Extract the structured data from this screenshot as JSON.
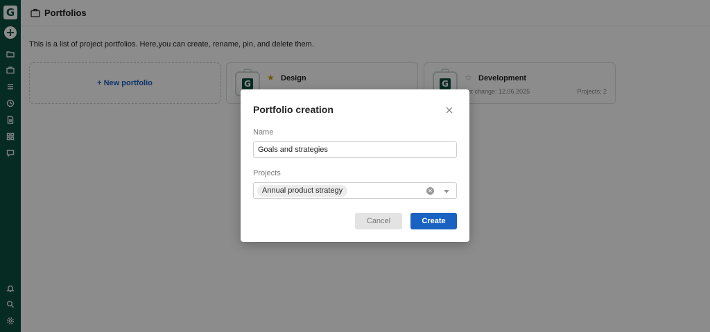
{
  "app": {
    "logo_letter": "G"
  },
  "sidebar": {
    "add_symbol": "+",
    "top_icons": [
      "folder-icon",
      "briefcase-icon",
      "list-icon",
      "clock-icon",
      "document-icon",
      "grid-icon",
      "chat-icon"
    ],
    "bottom_icons": [
      "bell-icon",
      "search-icon",
      "gear-icon"
    ]
  },
  "header": {
    "title": "Portfolios",
    "icon": "briefcase-icon"
  },
  "intro": "This is a list of project portfolios. Here,you can create, rename, pin, and delete them.",
  "new_portfolio": {
    "label": "+  New portfolio"
  },
  "portfolios": [
    {
      "name": "Design",
      "starred": true,
      "star": "★",
      "last_change": "",
      "projects": ""
    },
    {
      "name": "Development",
      "starred": false,
      "star": "☆",
      "last_change": "ast change: 12.06.2025",
      "projects": "Projects: 2"
    }
  ],
  "modal": {
    "title": "Portfolio creation",
    "name_label": "Name",
    "name_value": "Goals and strategies",
    "projects_label": "Projects",
    "selected_project": "Annual product strategy",
    "cancel_label": "Cancel",
    "create_label": "Create"
  },
  "colors": {
    "sidebar_bg": "#0b4f3f",
    "accent": "#1a62c2",
    "star": "#d99a12"
  }
}
